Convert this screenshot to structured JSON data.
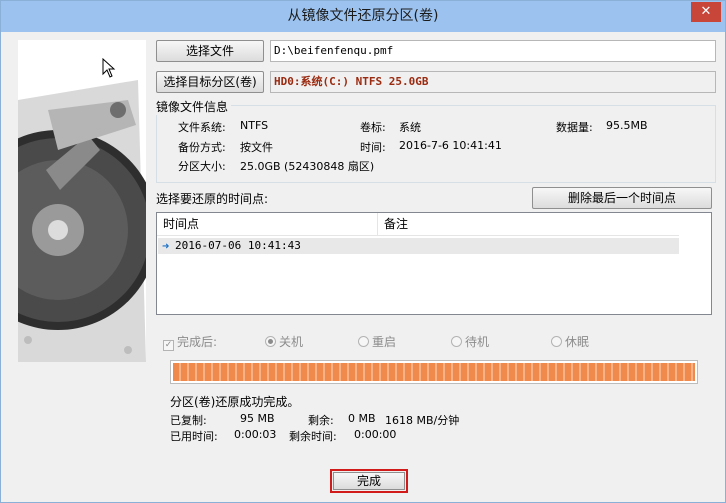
{
  "window": {
    "title": "从镜像文件还原分区(卷)",
    "close_label": "✕"
  },
  "top": {
    "choose_file_label": "选择文件",
    "file_path": "D:\\beifenfenqu.pmf",
    "choose_target_label": "选择目标分区(卷)",
    "target_value": "HD0:系统(C:) NTFS 25.0GB"
  },
  "image_info": {
    "title": "镜像文件信息",
    "fs_label": "文件系统:",
    "fs_value": "NTFS",
    "volume_label": "卷标:",
    "volume_value": "系统",
    "data_label": "数据量:",
    "data_value": "95.5MB",
    "backup_label": "备份方式:",
    "backup_value": "按文件",
    "time_label": "时间:",
    "time_value": "2016-7-6 10:41:41",
    "size_label": "分区大小:",
    "size_value": "25.0GB  (52430848 扇区)"
  },
  "timepoints": {
    "label": "选择要还原的时间点:",
    "delete_last_label": "删除最后一个时间点",
    "columns": [
      "时间点",
      "备注"
    ],
    "rows": [
      {
        "time": "2016-07-06 10:41:43",
        "note": ""
      }
    ]
  },
  "after": {
    "checkbox_label": "完成后:",
    "options": [
      "关机",
      "重启",
      "待机",
      "休眠"
    ],
    "selected": "关机"
  },
  "progress": {
    "fraction": 1.0
  },
  "status": {
    "message": "分区(卷)还原成功完成。",
    "copied_label": "已复制:",
    "copied_value": "95 MB",
    "remaining_label": "剩余:",
    "remaining_value": "0 MB",
    "speed_value": "1618 MB/分钟",
    "elapsed_label": "已用时间:",
    "elapsed_value": "0:00:03",
    "remaining_time_label": "剩余时间:",
    "remaining_time_value": "0:00:00"
  },
  "done_label": "完成",
  "colors": {
    "titlebar": "#9cc3ef",
    "progress": "#f08a4c",
    "target_text": "#9a2a10",
    "focus_border": "#d11a1a"
  }
}
